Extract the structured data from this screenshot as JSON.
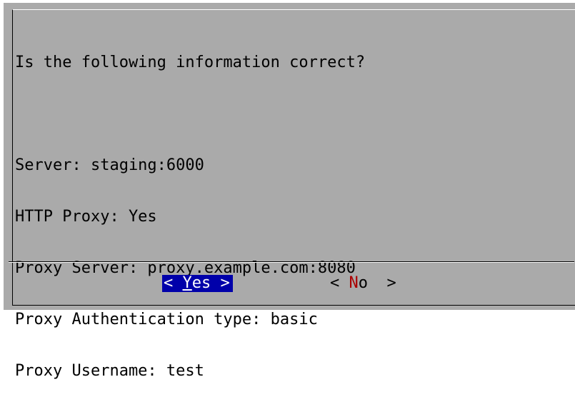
{
  "dialog": {
    "question": "Is the following information correct?",
    "details": [
      "Server: staging:6000",
      "HTTP Proxy: Yes",
      "Proxy Server: proxy.example.com:8080",
      "Proxy Authentication type: basic",
      "Proxy Username: test"
    ],
    "buttons": {
      "yes": {
        "left": "< ",
        "hotkey": "Y",
        "rest": "es",
        "right": " >",
        "selected": true
      },
      "no": {
        "left": "< ",
        "hotkey": "N",
        "rest": "o",
        "right": "  >",
        "selected": false
      }
    }
  },
  "colors": {
    "dialog_background": "#aaaaaa",
    "selected_button_background": "#0000aa",
    "selected_button_text": "#ffffff",
    "hotkey_color": "#aa0000",
    "text": "#000000"
  }
}
